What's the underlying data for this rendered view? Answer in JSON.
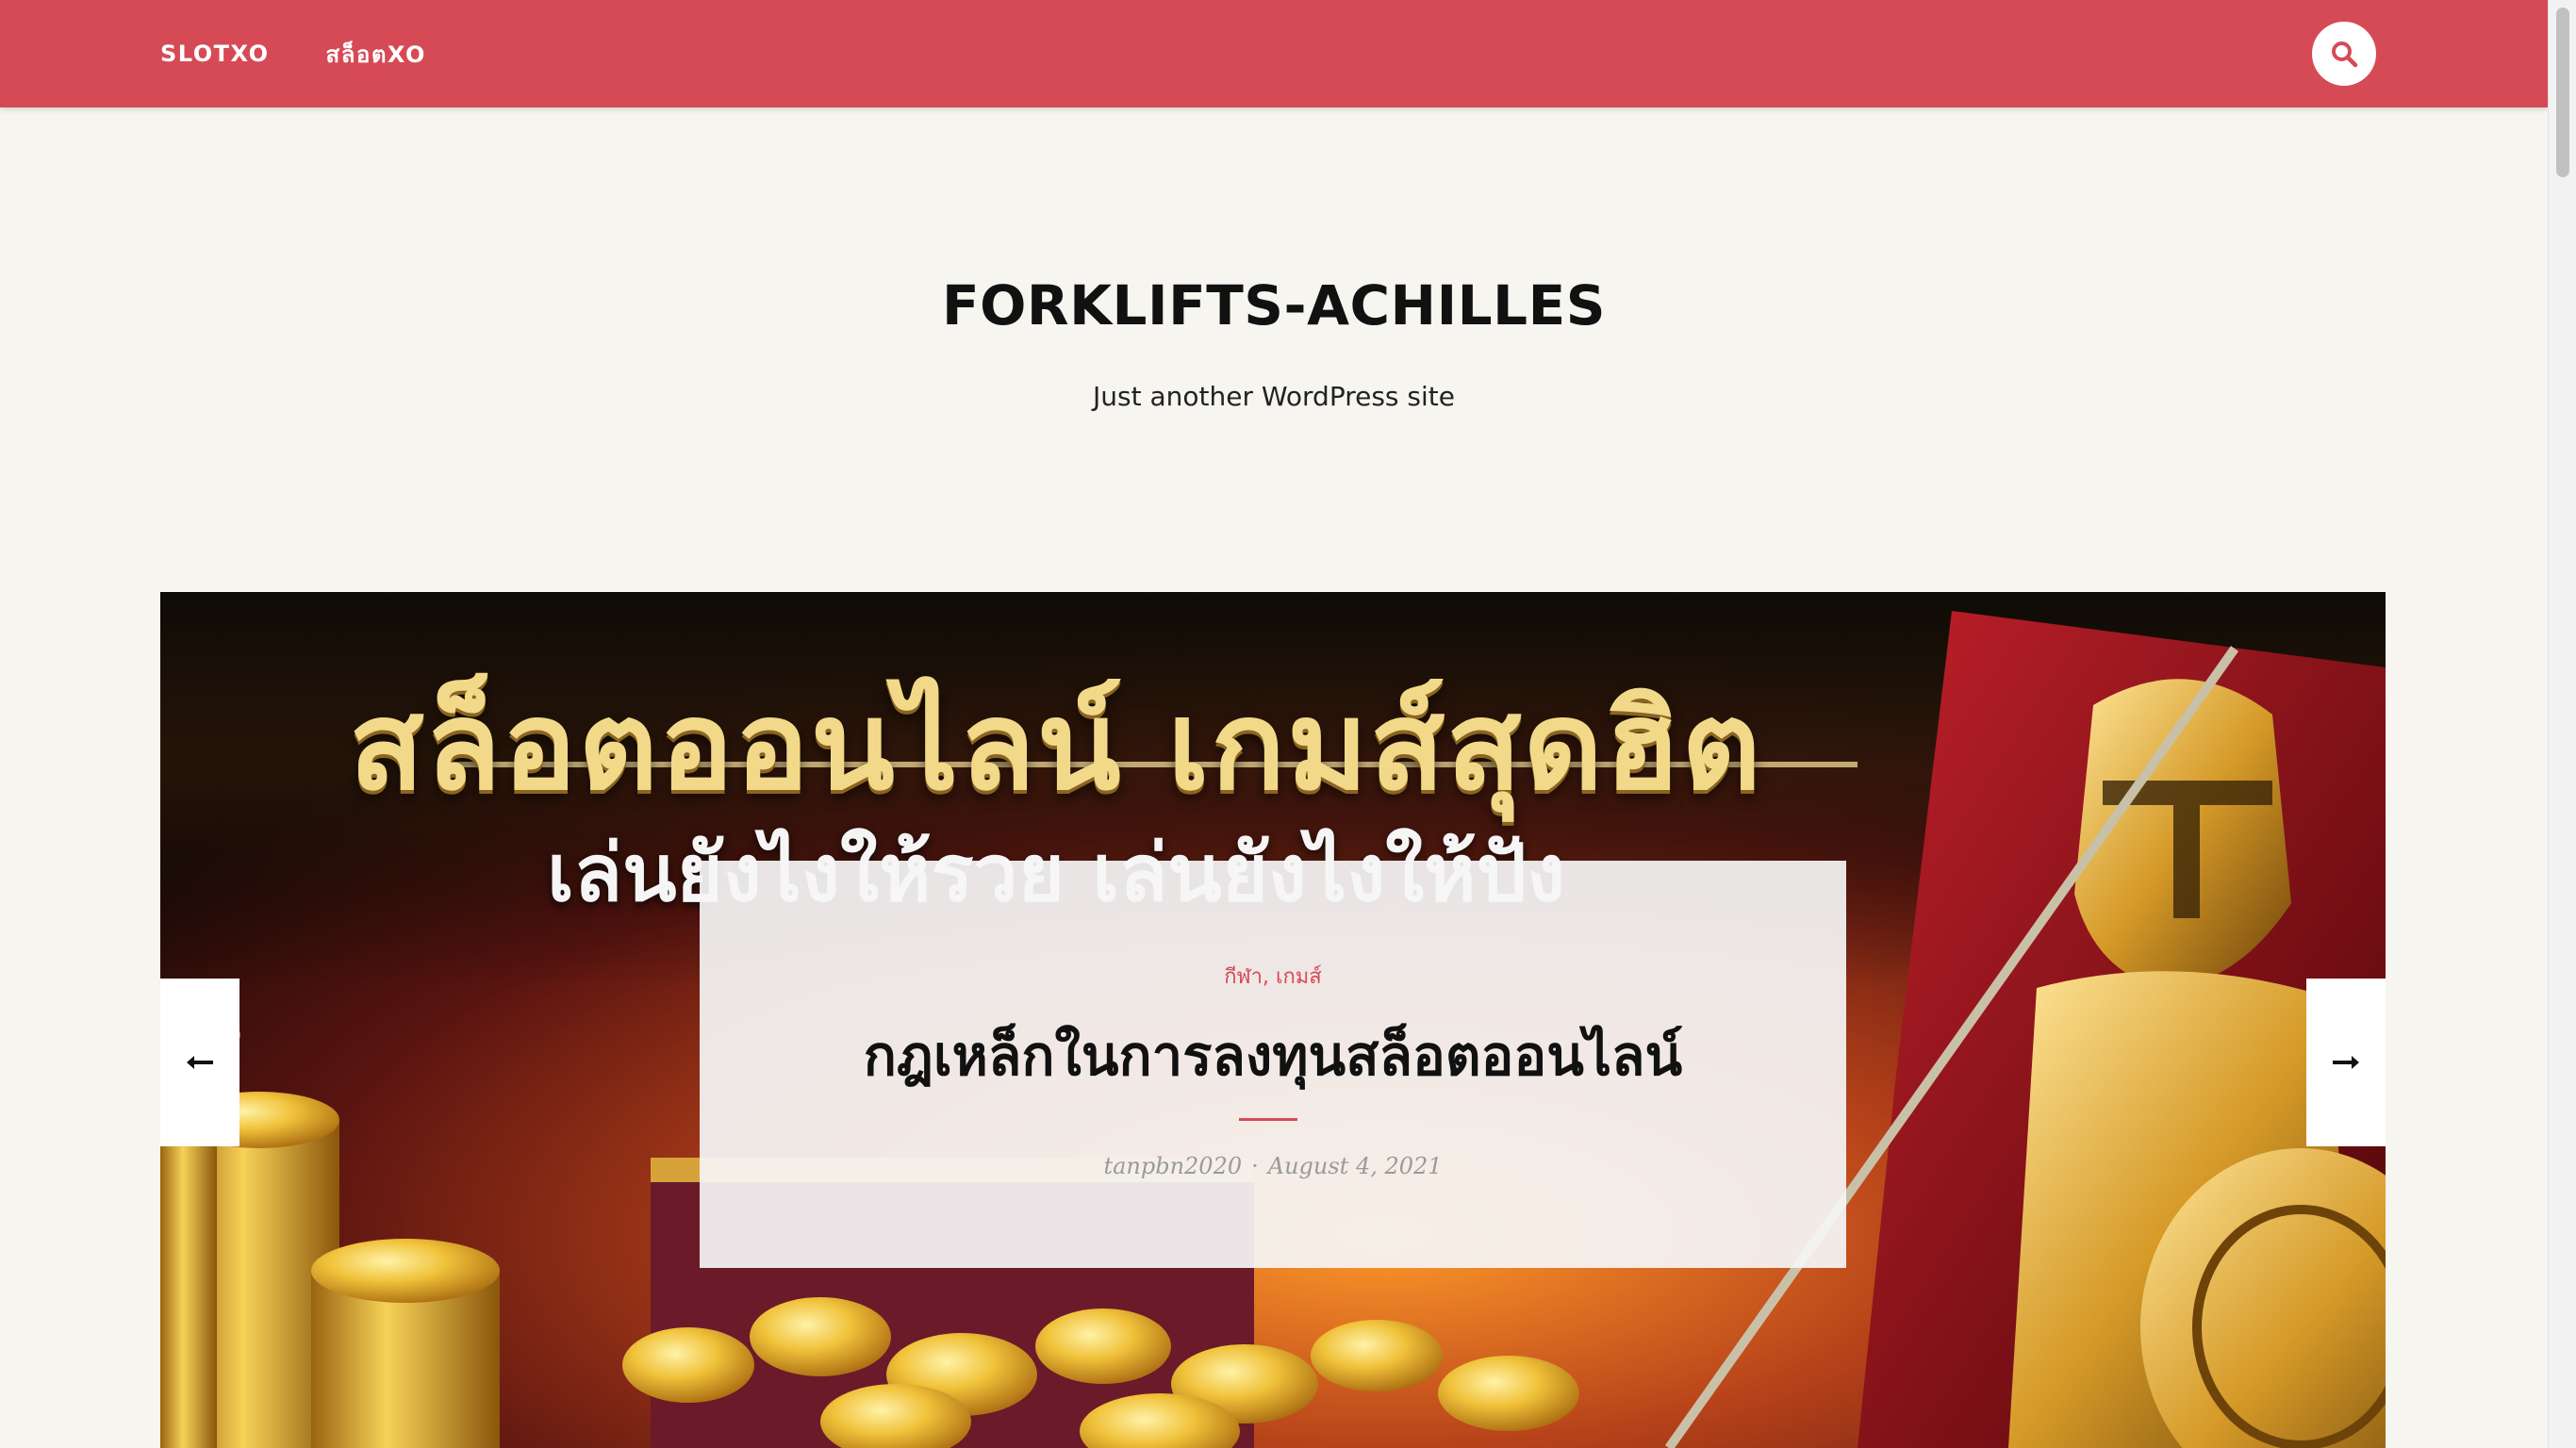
{
  "header": {
    "nav": [
      {
        "label": "SLOTXO"
      },
      {
        "label": "สล็อตXO"
      }
    ],
    "search_icon": "search-icon",
    "accent_color": "#d64a56"
  },
  "site": {
    "title": "FORKLIFTS-ACHILLES",
    "tagline": "Just another WordPress site"
  },
  "hero": {
    "banner_line1": "สล็อตออนไลน์ เกมส์สุดฮิต",
    "banner_line2": "เล่นยังไงให้รวย เล่นยังไงให้ปัง",
    "prev_icon": "arrow-left-icon",
    "next_icon": "arrow-right-icon"
  },
  "post": {
    "categories": [
      "กีฬา",
      "เกมส์"
    ],
    "category_separator": ",",
    "title": "กฎเหล็กในการลงทุนสล็อตออนไลน์",
    "author": "tanpbn2020",
    "meta_separator": "·",
    "date": "August 4, 2021"
  }
}
